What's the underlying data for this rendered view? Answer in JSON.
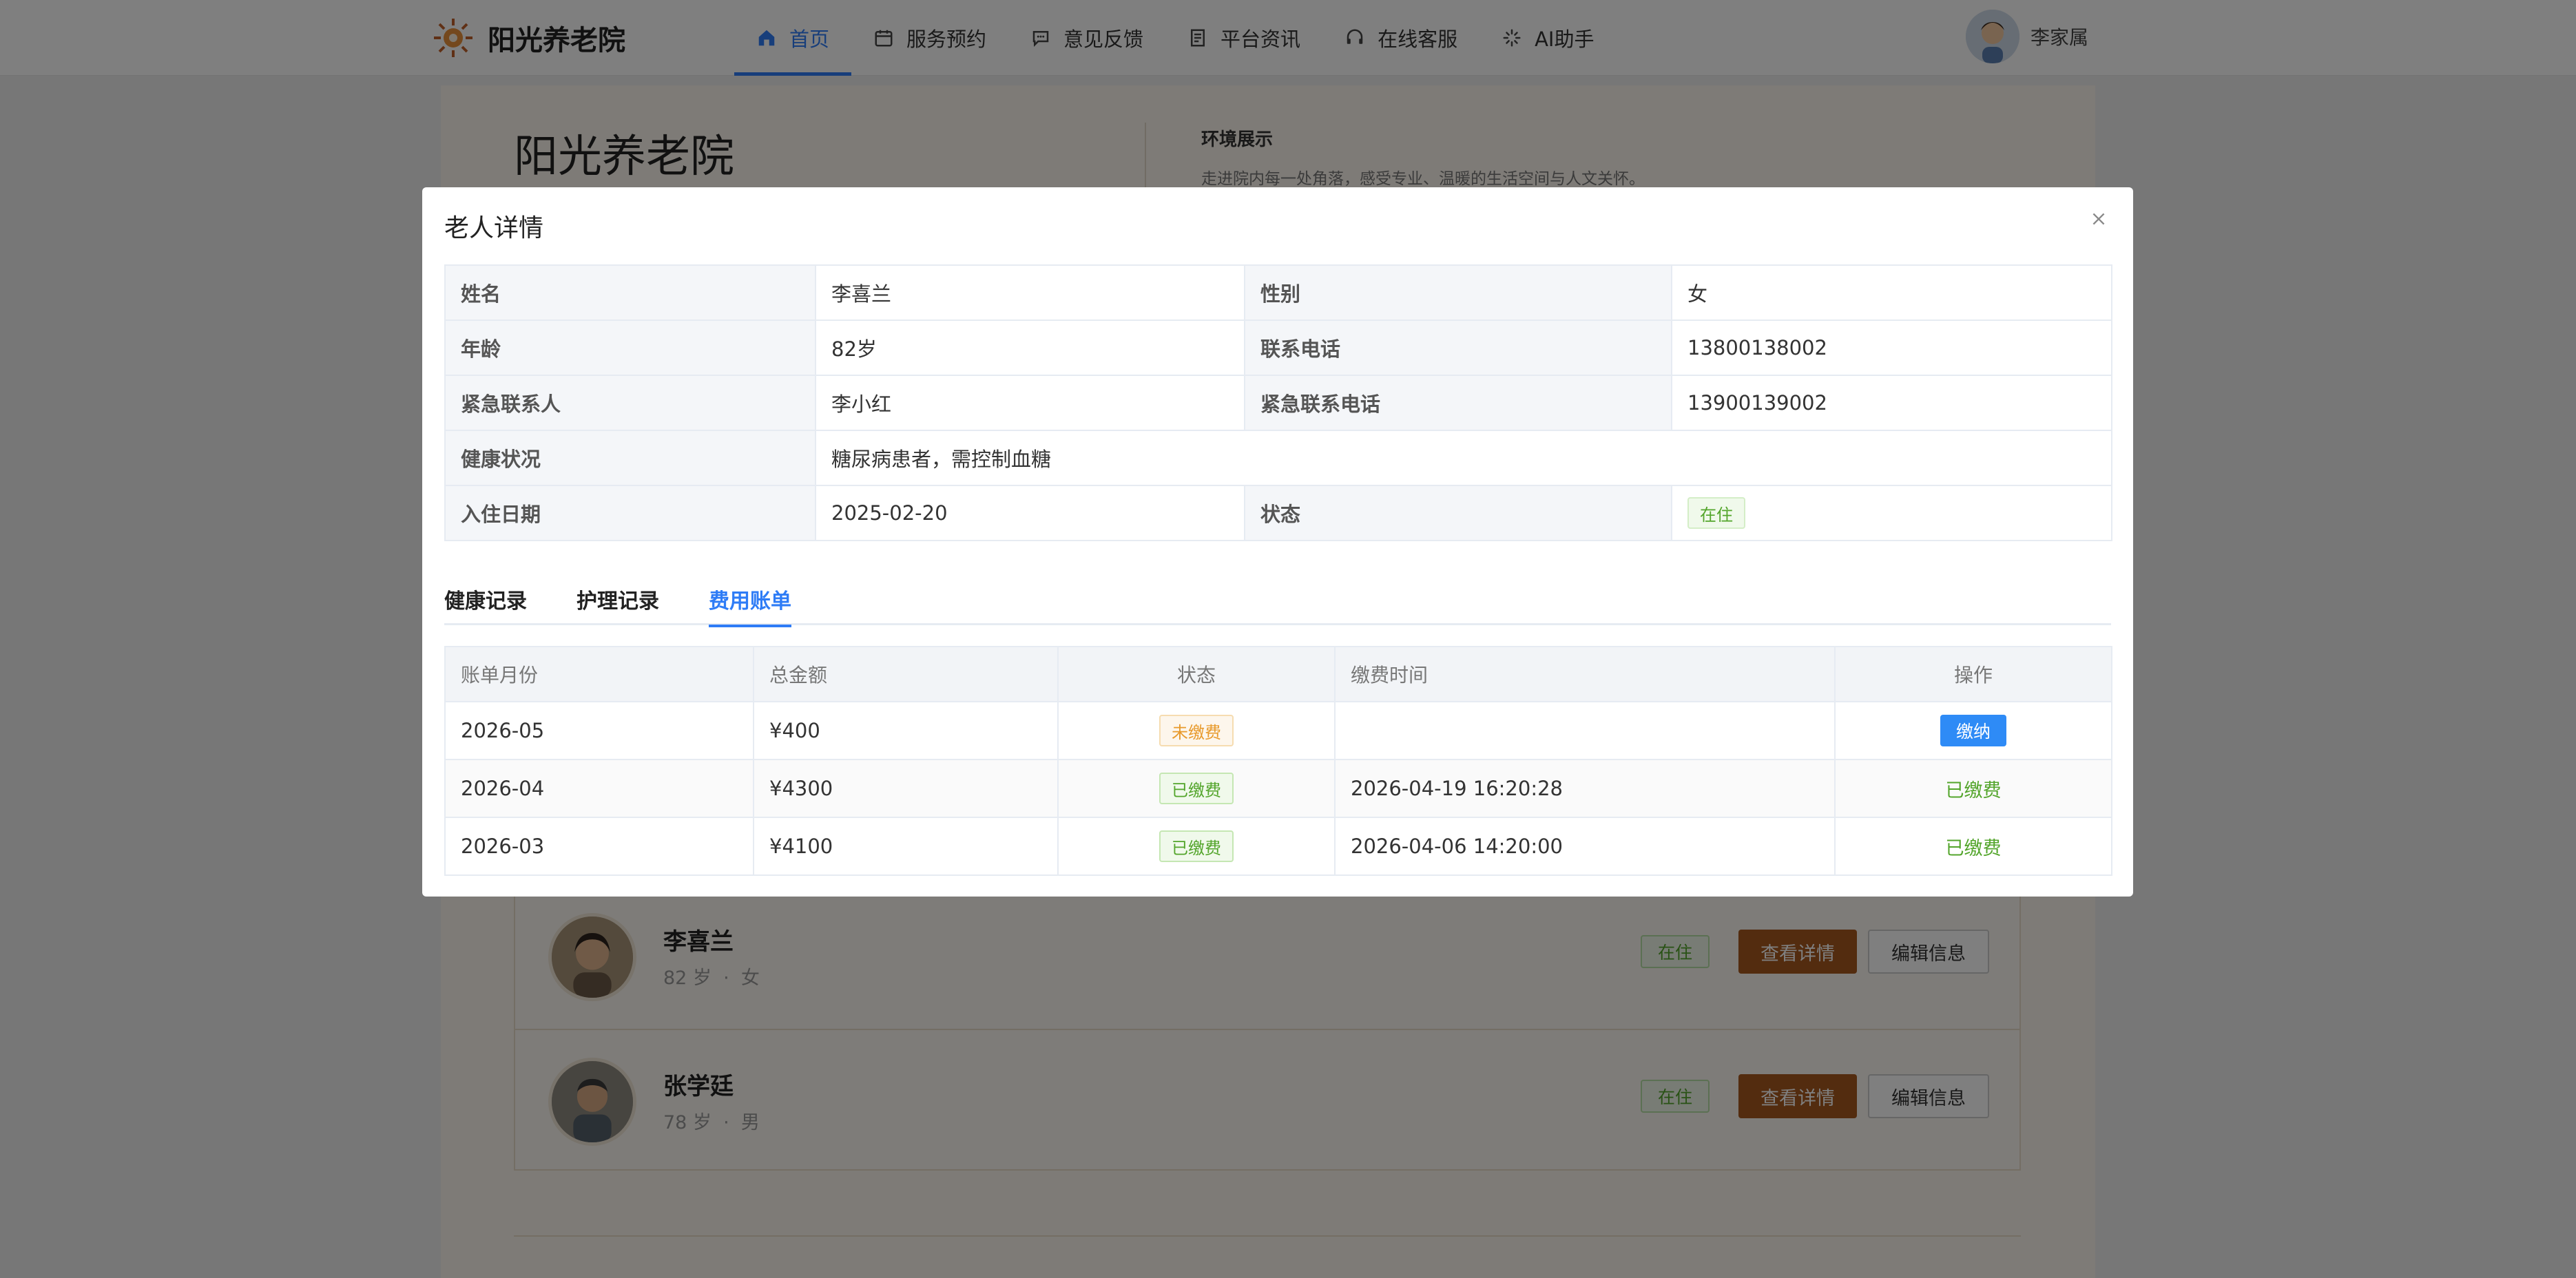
{
  "header": {
    "brand_name": "阳光养老院",
    "nav": [
      {
        "label": "首页",
        "icon": "home-icon"
      },
      {
        "label": "服务预约",
        "icon": "calendar-icon"
      },
      {
        "label": "意见反馈",
        "icon": "chat-icon"
      },
      {
        "label": "平台资讯",
        "icon": "news-icon"
      },
      {
        "label": "在线客服",
        "icon": "headset-icon"
      },
      {
        "label": "AI助手",
        "icon": "sparkle-icon"
      }
    ],
    "user_name": "李家属",
    "accent_color": "#2e7cf6"
  },
  "hero": {
    "title": "阳光养老院",
    "env_title": "环境展示",
    "env_desc": "走进院内每一处角落，感受专业、温暖的生活空间与人文关怀。"
  },
  "elders": [
    {
      "name": "李喜兰",
      "age": "82 岁",
      "gender": "女",
      "status": "在住",
      "detail_btn": "查看详情",
      "edit_btn": "编辑信息"
    },
    {
      "name": "张学廷",
      "age": "78 岁",
      "gender": "男",
      "status": "在住",
      "detail_btn": "查看详情",
      "edit_btn": "编辑信息"
    }
  ],
  "modal": {
    "title": "老人详情",
    "fields": {
      "name_label": "姓名",
      "name": "李喜兰",
      "gender_label": "性别",
      "gender": "女",
      "age_label": "年龄",
      "age": "82岁",
      "phone_label": "联系电话",
      "phone": "13800138002",
      "contact_label": "紧急联系人",
      "contact": "李小红",
      "contact_phone_label": "紧急联系电话",
      "contact_phone": "13900139002",
      "health_label": "健康状况",
      "health": "糖尿病患者，需控制血糖",
      "checkin_label": "入住日期",
      "checkin": "2025-02-20",
      "status_label": "状态",
      "status": "在住"
    },
    "tabs": [
      "健康记录",
      "护理记录",
      "费用账单"
    ],
    "active_tab": "费用账单",
    "bill_headers": [
      "账单月份",
      "总金额",
      "状态",
      "缴费时间",
      "操作"
    ],
    "bills": [
      {
        "month": "2026-05",
        "amount": "¥400",
        "status": "未缴费",
        "paid_time": "",
        "action": "缴纳"
      },
      {
        "month": "2026-04",
        "amount": "¥4300",
        "status": "已缴费",
        "paid_time": "2026-04-19 16:20:28",
        "action": "已缴费"
      },
      {
        "month": "2026-03",
        "amount": "¥4100",
        "status": "已缴费",
        "paid_time": "2026-04-06 14:20:00",
        "action": "已缴费"
      }
    ]
  }
}
